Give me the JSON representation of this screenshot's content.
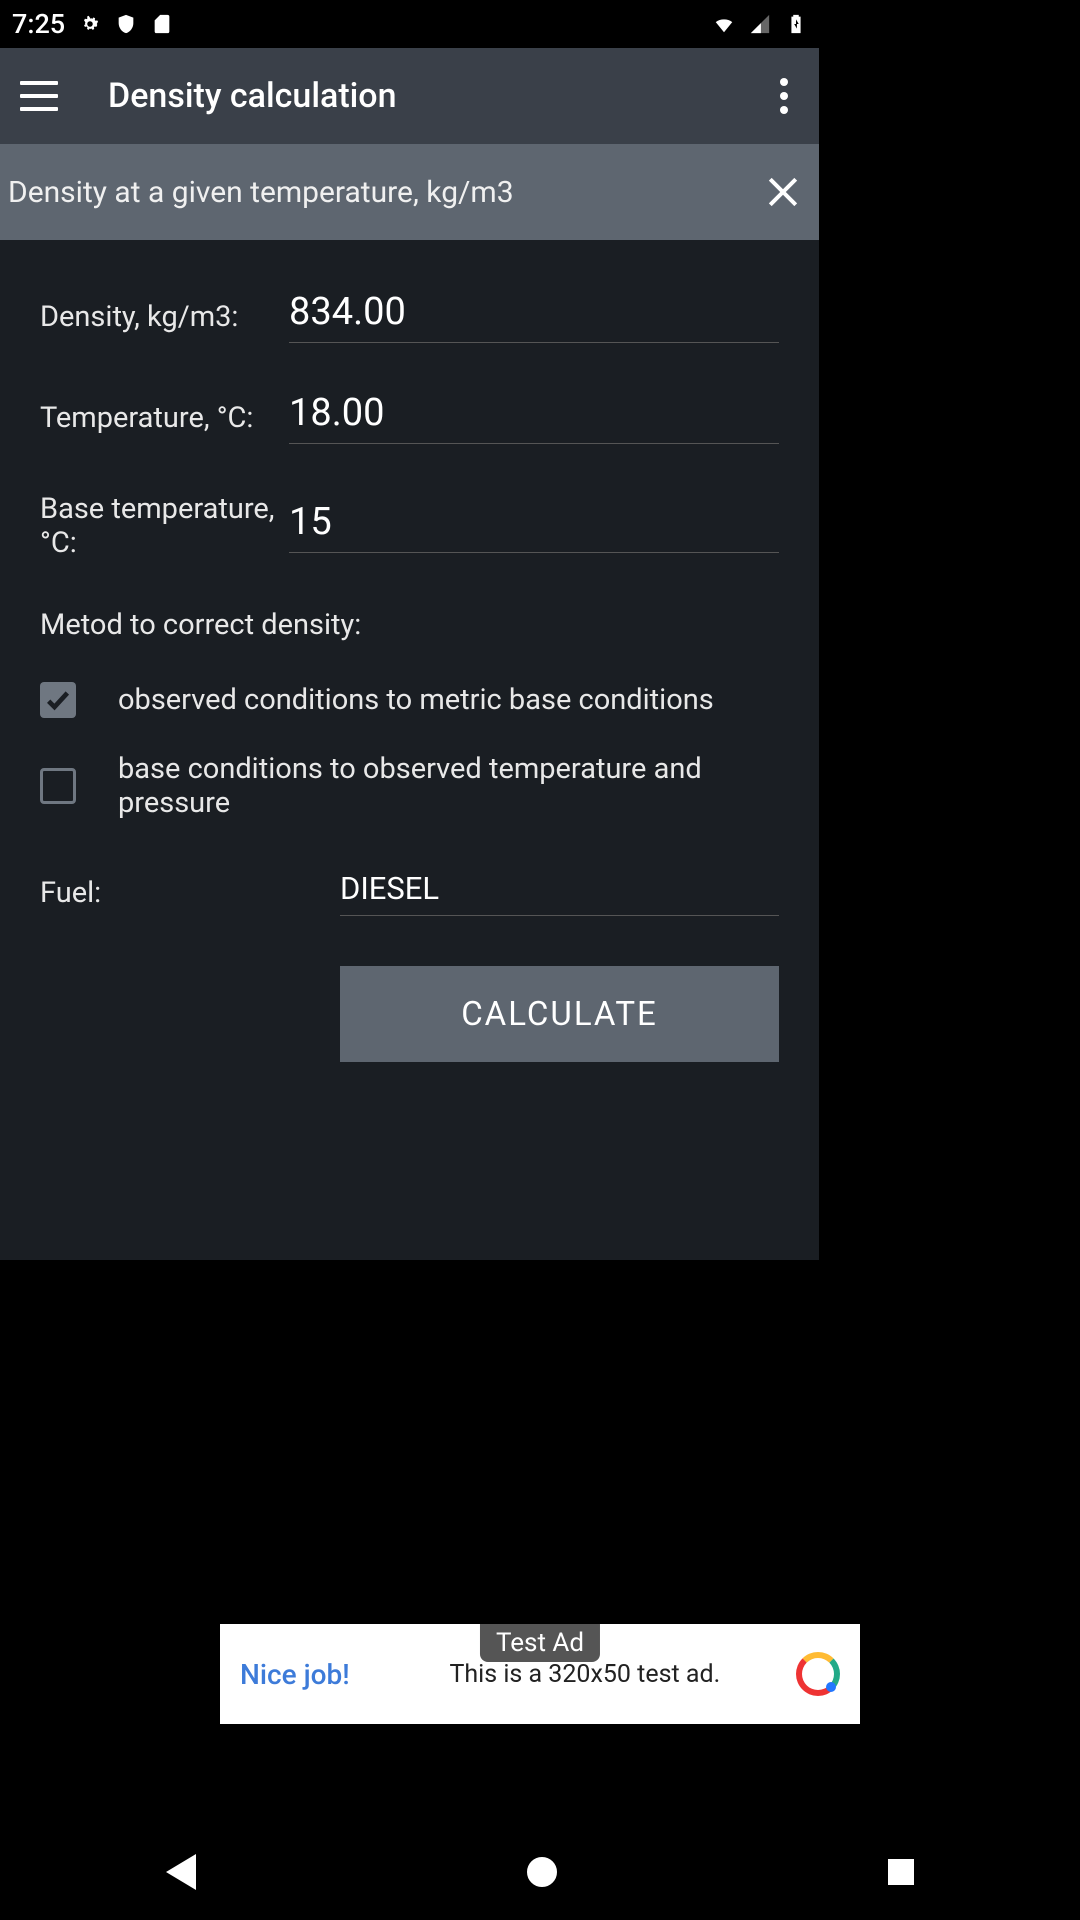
{
  "status": {
    "time": "7:25"
  },
  "appbar": {
    "title": "Density calculation"
  },
  "banner": {
    "text": "Density at a given temperature, kg/m3"
  },
  "fields": {
    "density_label": "Density, kg/m3:",
    "density_value": "834.00",
    "temp_label": "Temperature, °C:",
    "temp_value": "18.00",
    "base_temp_label": "Base temperature, °C:",
    "base_temp_value": "15"
  },
  "method": {
    "title": "Metod to correct density:",
    "opt1": "observed conditions to metric base conditions",
    "opt2": "base conditions to observed temperature and pressure"
  },
  "fuel": {
    "label": "Fuel:",
    "value": "DIESEL"
  },
  "button": {
    "calculate": "CALCULATE"
  },
  "ad": {
    "badge": "Test Ad",
    "left": "Nice job!",
    "center": "This is a 320x50 test ad."
  }
}
